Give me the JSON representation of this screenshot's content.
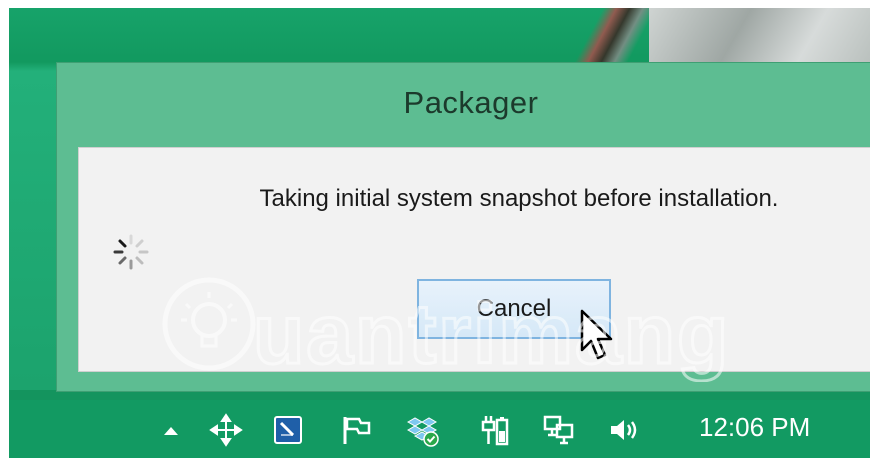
{
  "dialog": {
    "title": "Packager",
    "message": "Taking initial system snapshot before installation.",
    "cancel_label": "Cancel"
  },
  "watermark": {
    "text": "uantrimang"
  },
  "taskbar": {
    "tray_icons": [
      "show-hidden-icons-arrow",
      "move-arrows-icon",
      "powershell-icon",
      "action-center-flag-icon",
      "dropbox-icon",
      "power-battery-icon",
      "network-icon",
      "volume-icon"
    ],
    "clock": "12:06 PM"
  },
  "colors": {
    "dialog_frame": "#5dbd92",
    "dialog_body": "#f2f2f2",
    "taskbar": "#129a62",
    "button_border": "#7fb4e0"
  }
}
